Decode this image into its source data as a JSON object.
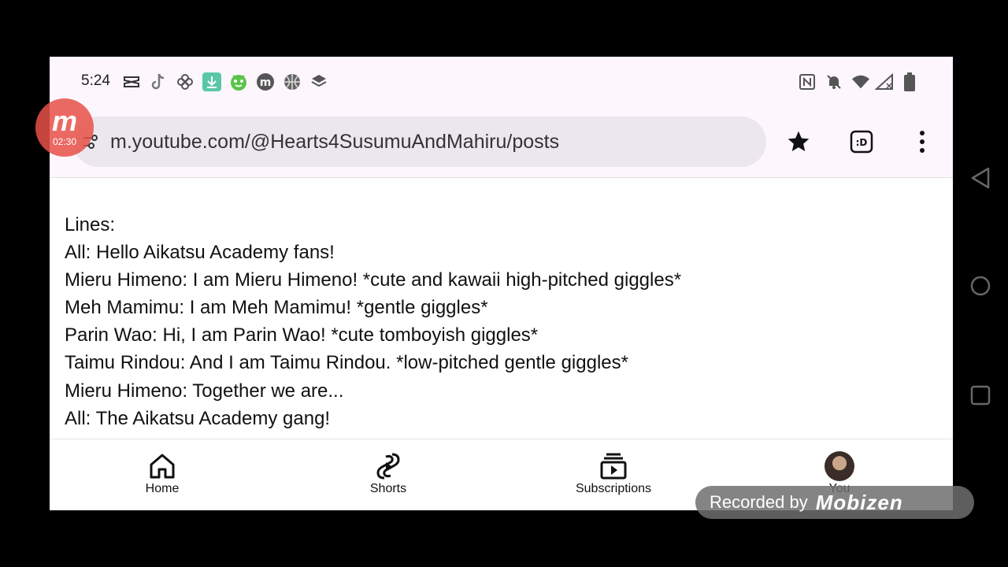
{
  "status_bar": {
    "time": "5:24",
    "left_icons": [
      "capcut-icon",
      "tiktok-icon",
      "pinwheel-icon",
      "download-icon",
      "android-bot-icon",
      "m-circle-icon",
      "basketball-icon",
      "layers-icon"
    ],
    "right_icons": [
      "nfc-icon",
      "bell-muted-icon",
      "wifi-icon",
      "signal-icon",
      "battery-icon"
    ]
  },
  "browser": {
    "url": "m.youtube.com/@Hearts4SusumuAndMahiru/posts",
    "toolbar_icons": [
      "star-icon",
      "tab-switcher-icon",
      "more-vert-icon"
    ]
  },
  "post": {
    "lines": [
      "Lines:",
      "All: Hello Aikatsu Academy fans!",
      "Mieru Himeno: I am Mieru Himeno! *cute and kawaii high-pitched giggles*",
      "Meh Mamimu: I am Meh Mamimu! *gentle giggles*",
      "Parin Wao: Hi, I am Parin Wao! *cute tomboyish giggles*",
      "Taimu Rindou: And I am Taimu Rindou. *low-pitched gentle giggles*",
      "Mieru Himeno: Together we are...",
      "All: The Aikatsu Academy gang!"
    ]
  },
  "bottom_nav": {
    "items": [
      {
        "label": "Home",
        "icon": "home-icon"
      },
      {
        "label": "Shorts",
        "icon": "shorts-icon"
      },
      {
        "label": "Subscriptions",
        "icon": "subscriptions-icon"
      },
      {
        "label": "You",
        "icon": "avatar"
      }
    ]
  },
  "overlay": {
    "mobizen_letter": "m",
    "timer": "02:30",
    "recorded_by": "Recorded by",
    "logo": "Mobizen"
  },
  "colors": {
    "status_bg": "#fdf6fd",
    "url_pill": "#ece6ee",
    "mobizen_red": "#e85048"
  }
}
